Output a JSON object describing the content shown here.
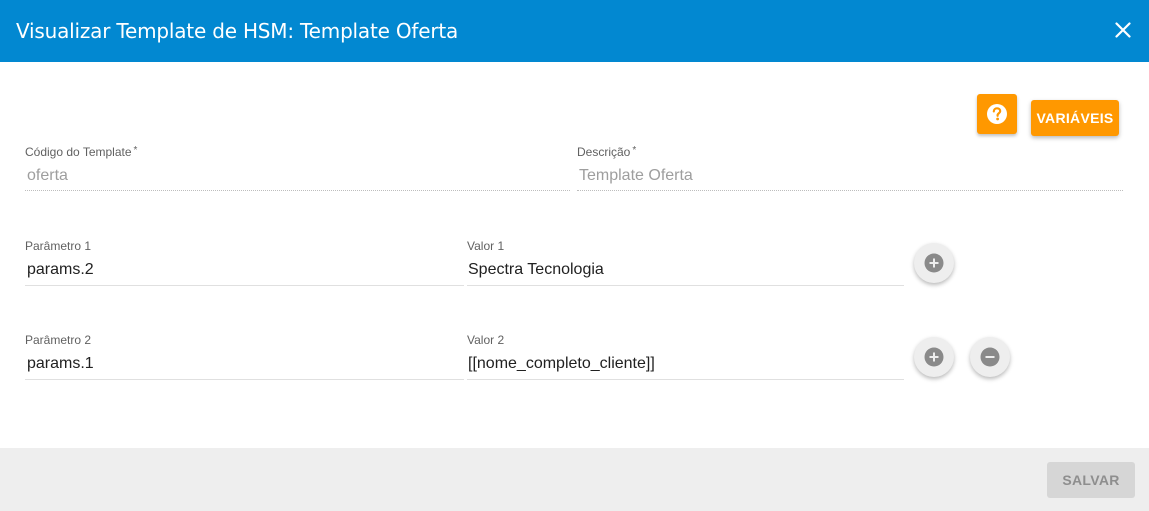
{
  "dialog": {
    "title": "Visualizar Template de HSM: Template Oferta"
  },
  "toolbar": {
    "help_icon": "question-circle-icon",
    "variables_label": "VARIÁVEIS"
  },
  "form": {
    "template_code": {
      "label": "Código do Template",
      "required_mark": "*",
      "value": "oferta"
    },
    "description": {
      "label": "Descrição",
      "required_mark": "*",
      "value": "Template Oferta"
    }
  },
  "params": [
    {
      "param_label": "Parâmetro 1",
      "param_value": "params.2",
      "value_label": "Valor 1",
      "value_value": "Spectra Tecnologia"
    },
    {
      "param_label": "Parâmetro 2",
      "param_value": "params.1",
      "value_label": "Valor 2",
      "value_value": "[[nome_completo_cliente]]"
    }
  ],
  "footer": {
    "save_label": "SALVAR"
  },
  "colors": {
    "header": "#0288d1",
    "accent": "#ff9800",
    "footer": "#eeeeee"
  }
}
